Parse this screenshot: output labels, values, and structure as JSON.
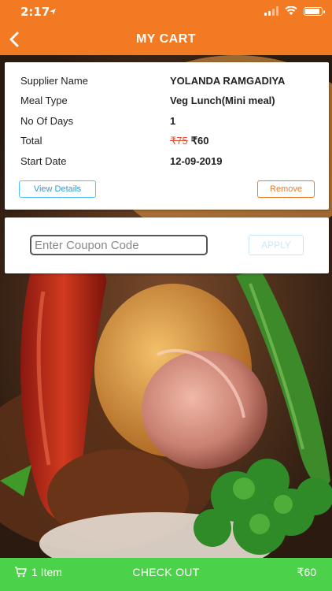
{
  "status_bar": {
    "time": "2:17"
  },
  "header": {
    "title": "MY CART"
  },
  "cart": {
    "rows": [
      {
        "label": "Supplier Name",
        "value": "YOLANDA RAMGADIYA"
      },
      {
        "label": "Meal Type",
        "value": "Veg Lunch(Mini meal)"
      },
      {
        "label": "No Of Days",
        "value": "1"
      },
      {
        "label": "Total",
        "old_price": "₹75",
        "value": "₹60"
      },
      {
        "label": "Start Date",
        "value": "12-09-2019"
      }
    ],
    "view_details_label": "View Details",
    "remove_label": "Remove"
  },
  "coupon": {
    "placeholder": "Enter Coupon Code",
    "value": "",
    "apply_label": "APPLY"
  },
  "bottom_bar": {
    "item_count": "1 Item",
    "checkout_label": "CHECK OUT",
    "total": "₹60"
  },
  "colors": {
    "primary": "#f27a23",
    "checkout": "#4cd14a",
    "info": "#4fc3f7",
    "strike": "#e34c2f"
  }
}
